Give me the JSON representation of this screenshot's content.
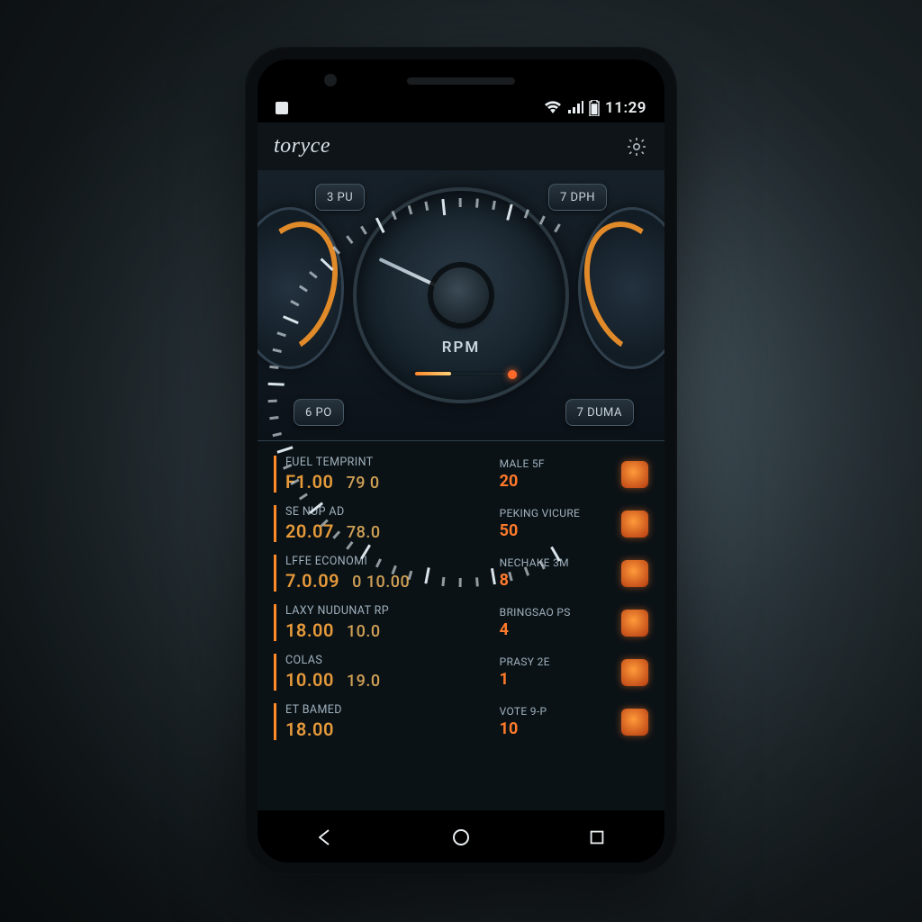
{
  "status": {
    "time": "11:29"
  },
  "app": {
    "title": "toryce"
  },
  "gauge": {
    "center_label": "RPM",
    "pill_tl": "3 PU",
    "pill_tr": "7 DPH",
    "pill_bl": "6 PO",
    "pill_br": "7 DUMA"
  },
  "rows": [
    {
      "left_label": "FUEL TEMPRINT",
      "left_v1": "F1.00",
      "left_v2": "79 0",
      "right_label": "MALE  5F",
      "right_val": "20"
    },
    {
      "left_label": "SE NUP AD",
      "left_v1": "20.07",
      "left_v2": "78.0",
      "right_label": "PEKING VICURE",
      "right_val": "50"
    },
    {
      "left_label": "LFFE ECONOMI",
      "left_v1": "7.0.09",
      "left_v2": "0  10.00",
      "right_label": "NECHAKE  3M",
      "right_val": "8"
    },
    {
      "left_label": "LAXY NUDUNAT RP",
      "left_v1": "18.00",
      "left_v2": "10.0",
      "right_label": "BRINGSAO  PS",
      "right_val": "4"
    },
    {
      "left_label": "COLAS",
      "left_v1": "10.00",
      "left_v2": "19.0",
      "right_label": "PRASY  2E",
      "right_val": "1"
    },
    {
      "left_label": "ET BAMED",
      "left_v1": "18.00",
      "left_v2": "",
      "right_label": "VOTE  9-P",
      "right_val": "10"
    }
  ]
}
